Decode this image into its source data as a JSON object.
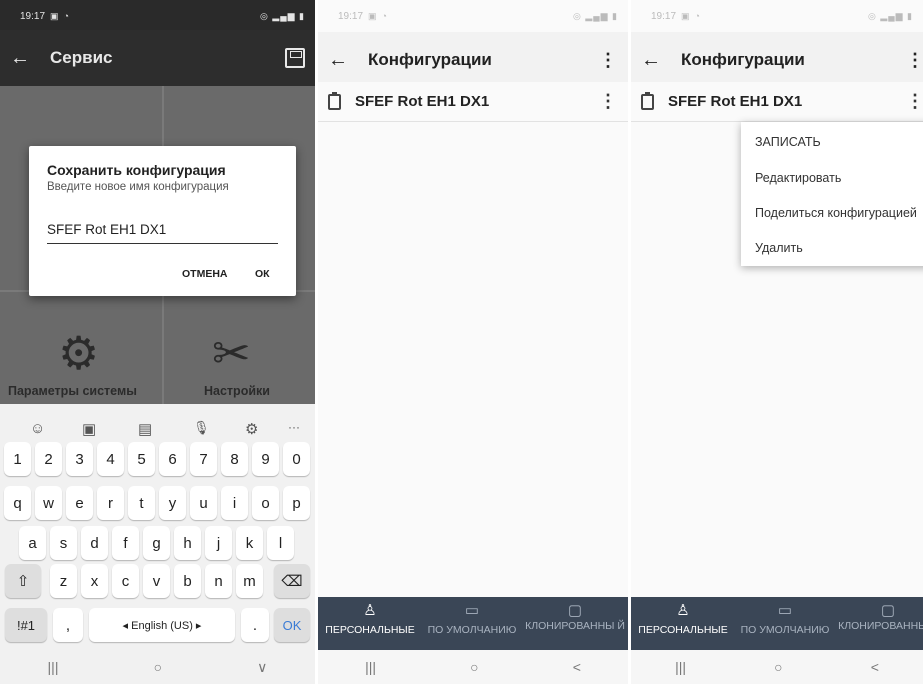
{
  "screen1": {
    "status": {
      "time": "19:17"
    },
    "appbar": {
      "back_icon": "←",
      "title": "Сервис",
      "save_icon": "save-icon"
    },
    "tiles": [
      {
        "label": "Параметры системы",
        "icon": "gear-icon"
      },
      {
        "label": "Настройки",
        "icon": "tools-icon"
      }
    ],
    "dialog": {
      "title": "Сохранить конфигурация",
      "subtitle": "Введите новое имя конфигурация",
      "input_value": "SFEF Rot EH1 DX1",
      "cancel": "ОТМЕНА",
      "ok": "ОК"
    },
    "keyboard": {
      "toolbar": [
        "☺",
        "▣",
        "▤",
        "🎙",
        "⚙",
        "···"
      ],
      "row_numbers": [
        "1",
        "2",
        "3",
        "4",
        "5",
        "6",
        "7",
        "8",
        "9",
        "0"
      ],
      "row_q": [
        "q",
        "w",
        "e",
        "r",
        "t",
        "y",
        "u",
        "i",
        "o",
        "p"
      ],
      "row_a": [
        "a",
        "s",
        "d",
        "f",
        "g",
        "h",
        "j",
        "k",
        "l"
      ],
      "row_z": [
        "z",
        "x",
        "c",
        "v",
        "b",
        "n",
        "m"
      ],
      "shift": "⇧",
      "backspace": "⌫",
      "symbols": "!#1",
      "comma": ",",
      "space": "◂ English (US) ▸",
      "period": ".",
      "ok": "OK"
    },
    "navbar": [
      "|||",
      "○",
      "∨"
    ]
  },
  "screen2": {
    "status": {
      "time": "19:17"
    },
    "appbar": {
      "back_icon": "←",
      "title": "Конфигурации",
      "menu_icon": "⋮"
    },
    "item": {
      "name": "SFEF Rot EH1 DX1",
      "menu_icon": "⋮"
    },
    "bottom_nav": [
      {
        "label": "ПЕРСОНАЛЬНЫЕ",
        "icon": "person-icon",
        "active": true
      },
      {
        "label": "ПО УМОЛЧАНИЮ",
        "icon": "factory-icon",
        "active": false
      },
      {
        "label": "КЛОНИРОВАННЫ Й",
        "icon": "clone-icon",
        "active": false
      }
    ],
    "navbar": [
      "|||",
      "○",
      "<"
    ]
  },
  "screen3": {
    "status": {
      "time": "19:17"
    },
    "appbar": {
      "back_icon": "←",
      "title": "Конфигурации",
      "menu_icon": "⋮"
    },
    "item": {
      "name": "SFEF Rot EH1 DX1",
      "menu_icon": "⋮"
    },
    "popup": [
      "ЗАПИСАТЬ",
      "Редактировать",
      "Поделиться конфигурацией",
      "Удалить"
    ],
    "bottom_nav": [
      {
        "label": "ПЕРСОНАЛЬНЫЕ",
        "icon": "person-icon",
        "active": true
      },
      {
        "label": "ПО УМОЛЧАНИЮ",
        "icon": "factory-icon",
        "active": false
      },
      {
        "label": "КЛОНИРОВАННЫ Й",
        "icon": "clone-icon",
        "active": false
      }
    ],
    "navbar": [
      "|||",
      "○",
      "<"
    ]
  }
}
